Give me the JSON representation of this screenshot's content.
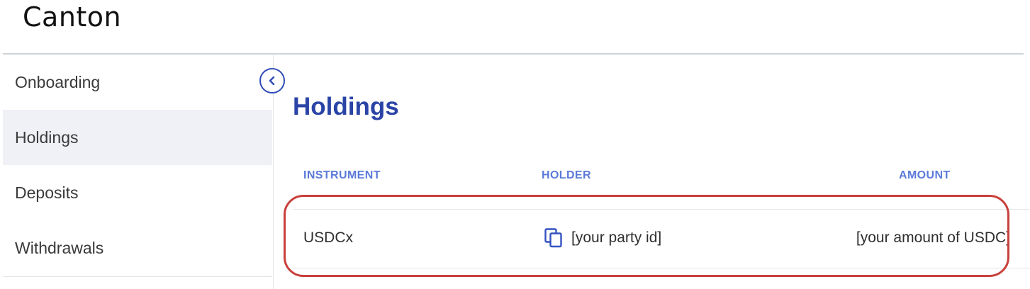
{
  "app": {
    "logo_text": "Canton"
  },
  "sidebar": {
    "items": [
      {
        "label": "Onboarding",
        "active": false
      },
      {
        "label": "Holdings",
        "active": true
      },
      {
        "label": "Deposits",
        "active": false
      },
      {
        "label": "Withdrawals",
        "active": false
      }
    ],
    "collapse_icon": "chevron-left-icon"
  },
  "main": {
    "title": "Holdings",
    "table": {
      "columns": [
        "INSTRUMENT",
        "HOLDER",
        "AMOUNT"
      ],
      "rows": [
        {
          "instrument": "USDCx",
          "holder": "[your party id]",
          "holder_icon": "copy-icon",
          "amount": "[your amount of USDC]"
        }
      ]
    }
  },
  "colors": {
    "accent": "#2a44a6",
    "column_header": "#5b7ad9",
    "active_sidebar_bg": "#eff1f6",
    "highlight_border": "#c8403a"
  }
}
